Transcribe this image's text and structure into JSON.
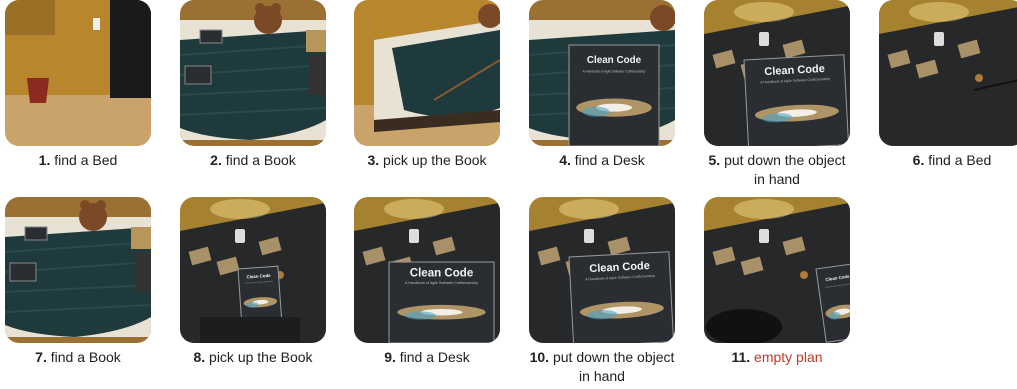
{
  "steps": [
    {
      "num": "1.",
      "text": "find a Bed",
      "scene": "room"
    },
    {
      "num": "2.",
      "text": "find a Book",
      "scene": "bed_top"
    },
    {
      "num": "3.",
      "text": "pick up the Book",
      "scene": "bed_side"
    },
    {
      "num": "4.",
      "text": "find a Desk",
      "scene": "book_hand_bed"
    },
    {
      "num": "5.",
      "text": "put down the object in hand",
      "scene": "desk_book"
    },
    {
      "num": "6.",
      "text": "find a Bed",
      "scene": "desk_empty"
    },
    {
      "num": "7.",
      "text": "find a Book",
      "scene": "bed_top"
    },
    {
      "num": "8.",
      "text": "pick up the Book",
      "scene": "desk_small_book"
    },
    {
      "num": "9.",
      "text": "find a Desk",
      "scene": "desk_book_hand"
    },
    {
      "num": "10.",
      "text": "put down the object in hand",
      "scene": "desk_book"
    },
    {
      "num": "11.",
      "text": "empty plan",
      "scene": "desk_book_edge",
      "highlight": true
    }
  ],
  "book_title": "Clean Code",
  "book_subtitle": "A Handbook of Agile Software Craftsmanship",
  "colors": {
    "caption_highlight": "#c0392b",
    "wall": "#b8862c",
    "floor": "#c9a36a",
    "blanket": "#1f3a3c",
    "desk": "#26282a"
  }
}
